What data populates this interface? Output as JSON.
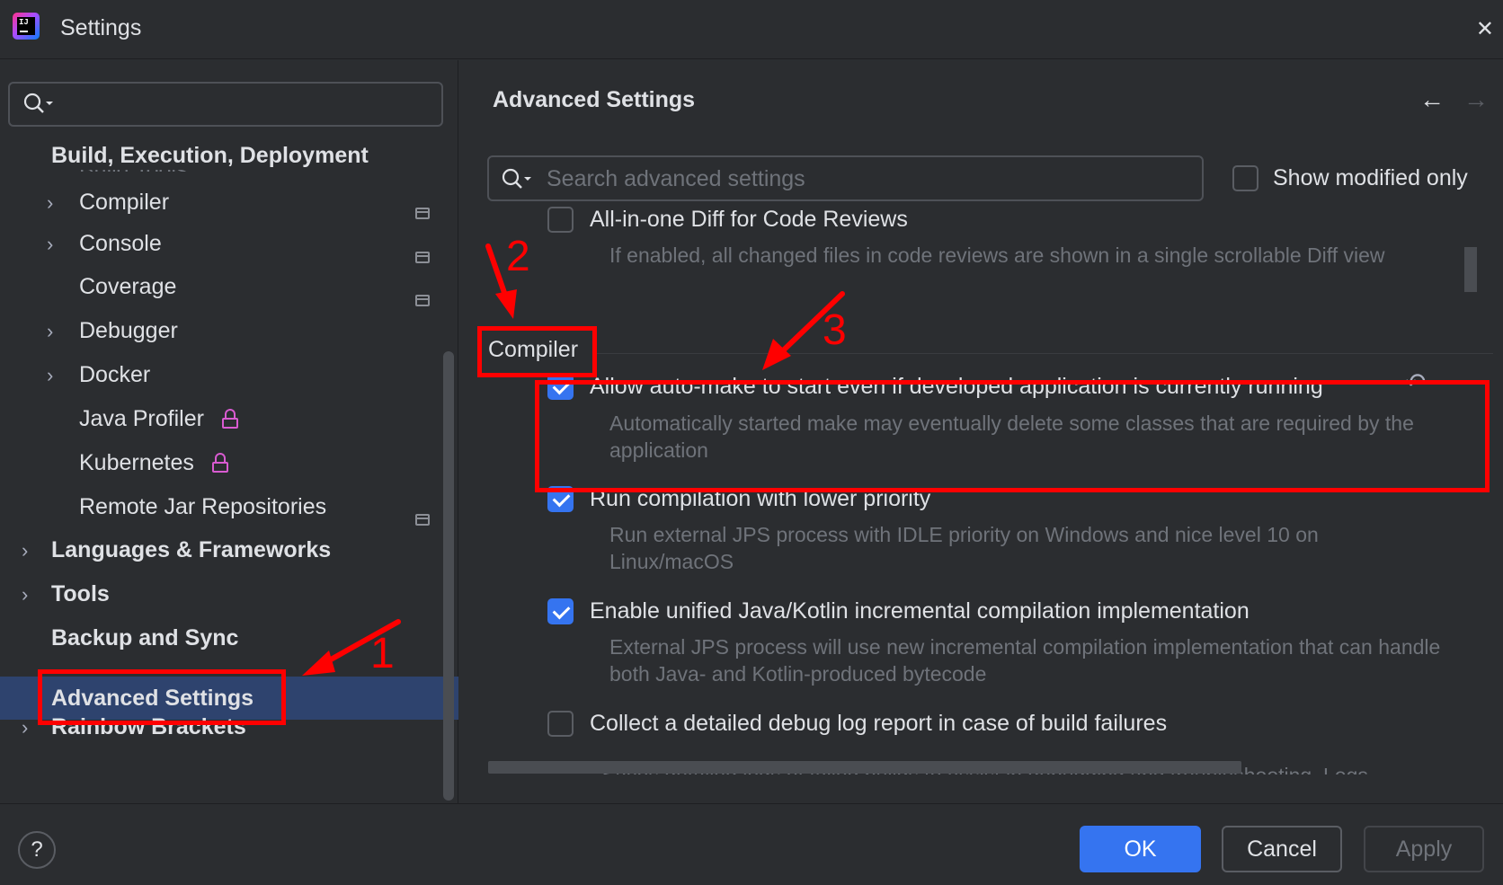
{
  "window": {
    "title": "Settings"
  },
  "sidebar": {
    "search_placeholder": "",
    "sticky_header": "Build, Execution, Deployment",
    "ghost_item": "Build Tools",
    "items": [
      {
        "label": "Compiler"
      },
      {
        "label": "Console"
      },
      {
        "label": "Coverage"
      },
      {
        "label": "Debugger"
      },
      {
        "label": "Docker"
      },
      {
        "label": "Java Profiler"
      },
      {
        "label": "Kubernetes"
      },
      {
        "label": "Remote Jar Repositories"
      },
      {
        "label": "Languages & Frameworks"
      },
      {
        "label": "Tools"
      },
      {
        "label": "Backup and Sync"
      },
      {
        "label": "Advanced Settings"
      },
      {
        "label": "Rainbow Brackets"
      }
    ]
  },
  "main": {
    "title": "Advanced Settings",
    "search_placeholder": "Search advanced settings",
    "show_modified_label": "Show modified only",
    "prev_option": {
      "label": "All-in-one Diff for Code Reviews",
      "desc": "If enabled, all changed files in code reviews are shown in a single scrollable Diff view"
    },
    "section": "Compiler",
    "options": [
      {
        "label": "Allow auto-make to start even if developed application is currently running",
        "desc": "Automatically started make may eventually delete some classes that are required by the application",
        "checked": true
      },
      {
        "label": "Run compilation with lower priority",
        "desc": "Run external JPS process with IDLE priority on Windows and nice level 10 on Linux/macOS",
        "checked": true
      },
      {
        "label": "Enable unified Java/Kotlin incremental compilation implementation",
        "desc": "External JPS process will use new incremental compilation implementation that can handle both Java- and Kotlin-produced bytecode",
        "checked": true
      },
      {
        "label": "Collect a detailed debug log report in case of build failures",
        "desc": "Saves detailed logs of failed builds to assist in debugging and troubleshooting. Logs",
        "checked": false
      }
    ]
  },
  "footer": {
    "help": "?",
    "ok": "OK",
    "cancel": "Cancel",
    "apply": "Apply"
  },
  "annotations": {
    "one": "1",
    "two": "2",
    "three": "3"
  },
  "colors": {
    "accent": "#3574f0",
    "selection": "#2e436e",
    "annotation": "#ff0000"
  }
}
